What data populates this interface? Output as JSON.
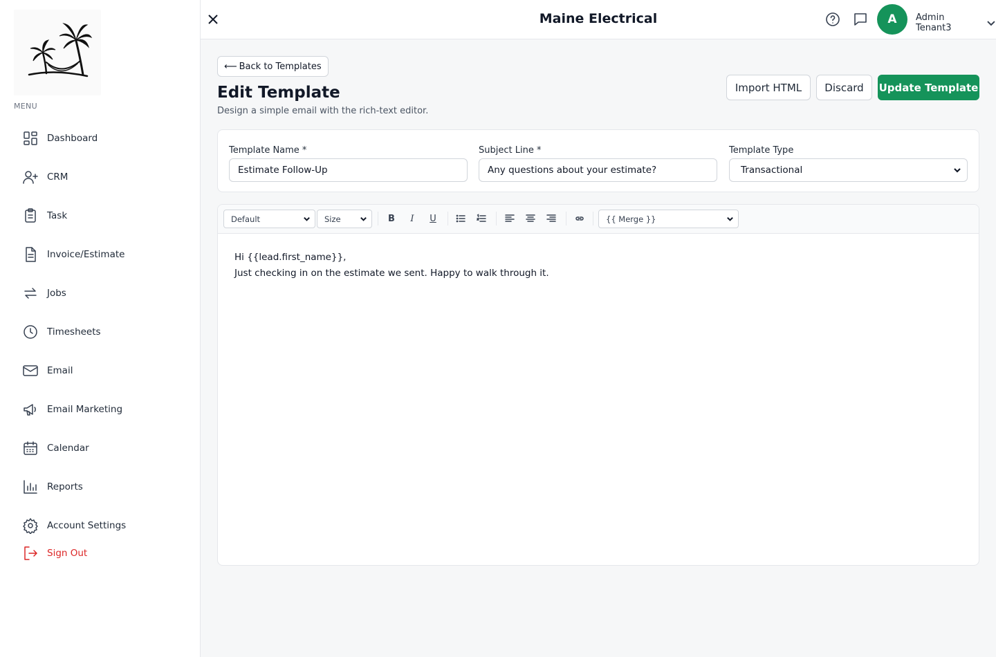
{
  "sidebar": {
    "menu_label": "MENU",
    "items": [
      {
        "label": "Dashboard",
        "icon": "dashboard-icon"
      },
      {
        "label": "CRM",
        "icon": "user-plus-icon"
      },
      {
        "label": "Task",
        "icon": "clipboard-icon"
      },
      {
        "label": "Invoice/Estimate",
        "icon": "document-icon"
      },
      {
        "label": "Jobs",
        "icon": "arrows-exchange-icon"
      },
      {
        "label": "Timesheets",
        "icon": "clock-icon"
      },
      {
        "label": "Email",
        "icon": "envelope-icon"
      },
      {
        "label": "Email Marketing",
        "icon": "megaphone-icon"
      },
      {
        "label": "Calendar",
        "icon": "calendar-icon"
      },
      {
        "label": "Reports",
        "icon": "bar-chart-icon"
      },
      {
        "label": "Account Settings",
        "icon": "gear-icon"
      }
    ],
    "sign_out": "Sign Out"
  },
  "header": {
    "title": "Maine Electrical",
    "avatar_initial": "A",
    "user_name": "Admin Tenant3"
  },
  "page": {
    "back_label": "Back to Templates",
    "title": "Edit Template",
    "subtitle": "Design a simple email with the rich-text editor.",
    "import_label": "Import HTML",
    "discard_label": "Discard",
    "update_label": "Update Template"
  },
  "form": {
    "name_label": "Template Name *",
    "name_value": "Estimate Follow-Up",
    "subject_label": "Subject Line *",
    "subject_value": "Any questions about your estimate?",
    "type_label": "Template Type",
    "type_value": "Transactional"
  },
  "editor": {
    "font_value": "Default",
    "size_value": "Size",
    "merge_value": "{{ Merge }}",
    "line1": "Hi {{lead.first_name}},",
    "line2": "Just checking in on the estimate we sent. Happy to walk through it."
  },
  "colors": {
    "primary": "#15935a",
    "signout": "#dc2626"
  }
}
